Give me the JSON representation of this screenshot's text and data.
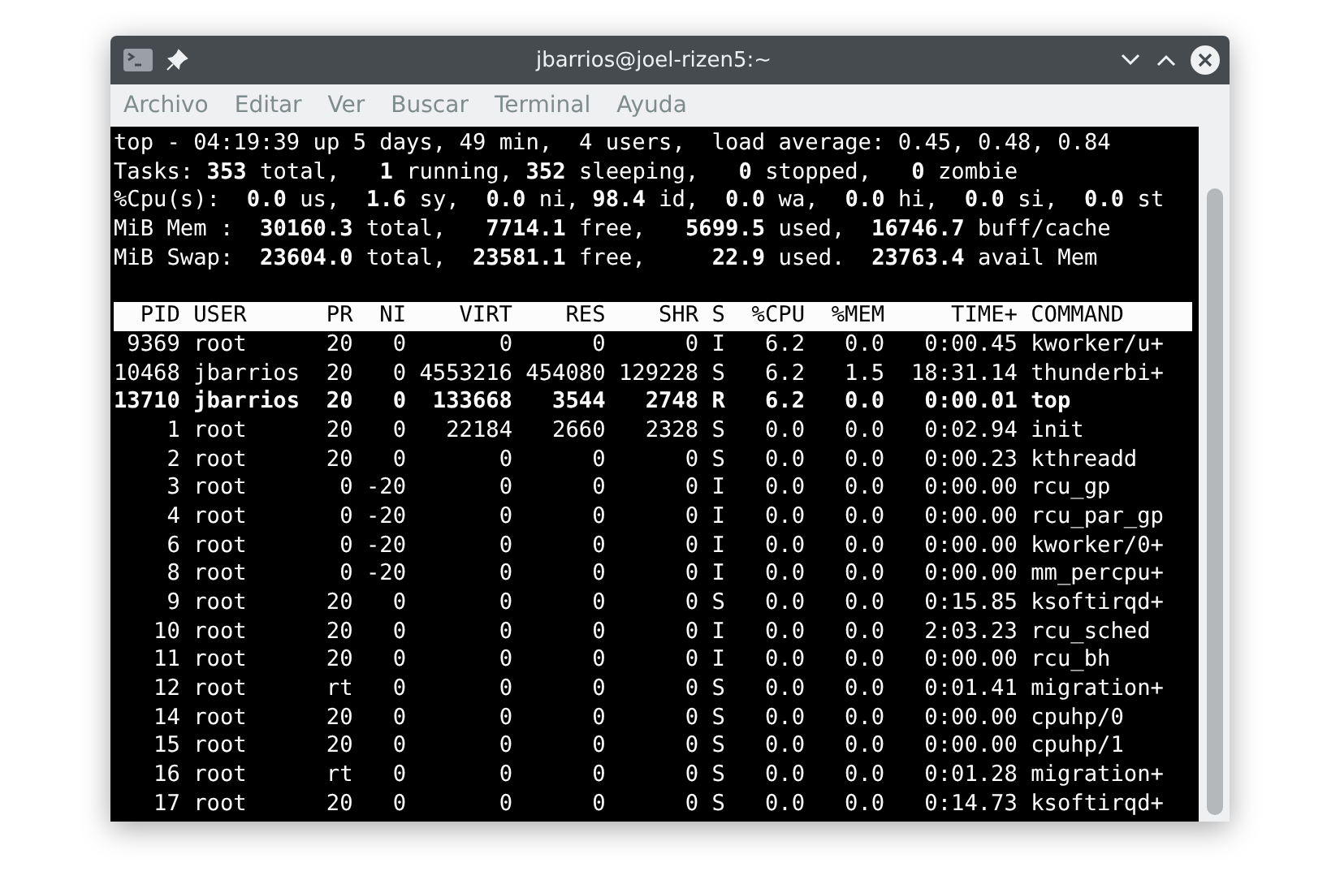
{
  "window": {
    "title": "jbarrios@joel-rizen5:~"
  },
  "menu": [
    "Archivo",
    "Editar",
    "Ver",
    "Buscar",
    "Terminal",
    "Ayuda"
  ],
  "summary": [
    "top - 04:19:39 up 5 days, 49 min,  4 users,  load average: 0.45, 0.48, 0.84",
    "Tasks: **353** total,   **1** running, **352** sleeping,   **0** stopped,   **0** zombie",
    "%Cpu(s):  **0.0** us,  **1.6** sy,  **0.0** ni, **98.4** id,  **0.0** wa,  **0.0** hi,  **0.0** si,  **0.0** st",
    "MiB Mem :  **30160.3** total,   **7714.1** free,   **5699.5** used,  **16746.7** buff/cache",
    "MiB Swap:  **23604.0** total,  **23581.1** free,     **22.9** used.  **23763.4** avail Mem"
  ],
  "table": {
    "columns": [
      "PID",
      "USER",
      "PR",
      "NI",
      "VIRT",
      "RES",
      "SHR",
      "S",
      "%CPU",
      "%MEM",
      "TIME+",
      "COMMAND"
    ],
    "rows": [
      {
        "cells": [
          "9369",
          "root",
          "20",
          "0",
          "0",
          "0",
          "0",
          "I",
          "6.2",
          "0.0",
          "0:00.45",
          "kworker/u+"
        ],
        "highlighted": false
      },
      {
        "cells": [
          "10468",
          "jbarrios",
          "20",
          "0",
          "4553216",
          "454080",
          "129228",
          "S",
          "6.2",
          "1.5",
          "18:31.14",
          "thunderbi+"
        ],
        "highlighted": false
      },
      {
        "cells": [
          "13710",
          "jbarrios",
          "20",
          "0",
          "133668",
          "3544",
          "2748",
          "R",
          "6.2",
          "0.0",
          "0:00.01",
          "top"
        ],
        "highlighted": true
      },
      {
        "cells": [
          "1",
          "root",
          "20",
          "0",
          "22184",
          "2660",
          "2328",
          "S",
          "0.0",
          "0.0",
          "0:02.94",
          "init"
        ],
        "highlighted": false
      },
      {
        "cells": [
          "2",
          "root",
          "20",
          "0",
          "0",
          "0",
          "0",
          "S",
          "0.0",
          "0.0",
          "0:00.23",
          "kthreadd"
        ],
        "highlighted": false
      },
      {
        "cells": [
          "3",
          "root",
          "0",
          "-20",
          "0",
          "0",
          "0",
          "I",
          "0.0",
          "0.0",
          "0:00.00",
          "rcu_gp"
        ],
        "highlighted": false
      },
      {
        "cells": [
          "4",
          "root",
          "0",
          "-20",
          "0",
          "0",
          "0",
          "I",
          "0.0",
          "0.0",
          "0:00.00",
          "rcu_par_gp"
        ],
        "highlighted": false
      },
      {
        "cells": [
          "6",
          "root",
          "0",
          "-20",
          "0",
          "0",
          "0",
          "I",
          "0.0",
          "0.0",
          "0:00.00",
          "kworker/0+"
        ],
        "highlighted": false
      },
      {
        "cells": [
          "8",
          "root",
          "0",
          "-20",
          "0",
          "0",
          "0",
          "I",
          "0.0",
          "0.0",
          "0:00.00",
          "mm_percpu+"
        ],
        "highlighted": false
      },
      {
        "cells": [
          "9",
          "root",
          "20",
          "0",
          "0",
          "0",
          "0",
          "S",
          "0.0",
          "0.0",
          "0:15.85",
          "ksoftirqd+"
        ],
        "highlighted": false
      },
      {
        "cells": [
          "10",
          "root",
          "20",
          "0",
          "0",
          "0",
          "0",
          "I",
          "0.0",
          "0.0",
          "2:03.23",
          "rcu_sched"
        ],
        "highlighted": false
      },
      {
        "cells": [
          "11",
          "root",
          "20",
          "0",
          "0",
          "0",
          "0",
          "I",
          "0.0",
          "0.0",
          "0:00.00",
          "rcu_bh"
        ],
        "highlighted": false
      },
      {
        "cells": [
          "12",
          "root",
          "rt",
          "0",
          "0",
          "0",
          "0",
          "S",
          "0.0",
          "0.0",
          "0:01.41",
          "migration+"
        ],
        "highlighted": false
      },
      {
        "cells": [
          "14",
          "root",
          "20",
          "0",
          "0",
          "0",
          "0",
          "S",
          "0.0",
          "0.0",
          "0:00.00",
          "cpuhp/0"
        ],
        "highlighted": false
      },
      {
        "cells": [
          "15",
          "root",
          "20",
          "0",
          "0",
          "0",
          "0",
          "S",
          "0.0",
          "0.0",
          "0:00.00",
          "cpuhp/1"
        ],
        "highlighted": false
      },
      {
        "cells": [
          "16",
          "root",
          "rt",
          "0",
          "0",
          "0",
          "0",
          "S",
          "0.0",
          "0.0",
          "0:01.28",
          "migration+"
        ],
        "highlighted": false
      },
      {
        "cells": [
          "17",
          "root",
          "20",
          "0",
          "0",
          "0",
          "0",
          "S",
          "0.0",
          "0.0",
          "0:14.73",
          "ksoftirqd+"
        ],
        "highlighted": false
      }
    ]
  }
}
